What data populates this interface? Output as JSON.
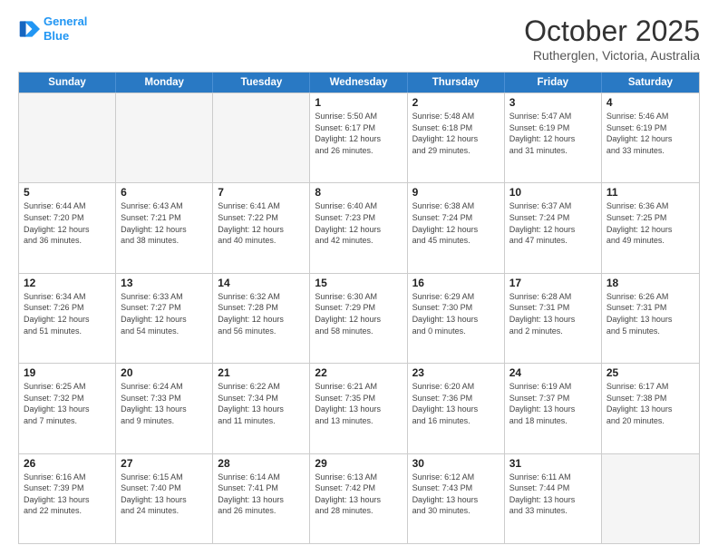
{
  "header": {
    "logo_line1": "General",
    "logo_line2": "Blue",
    "month": "October 2025",
    "location": "Rutherglen, Victoria, Australia"
  },
  "weekdays": [
    "Sunday",
    "Monday",
    "Tuesday",
    "Wednesday",
    "Thursday",
    "Friday",
    "Saturday"
  ],
  "rows": [
    [
      {
        "day": "",
        "info": ""
      },
      {
        "day": "",
        "info": ""
      },
      {
        "day": "",
        "info": ""
      },
      {
        "day": "1",
        "info": "Sunrise: 5:50 AM\nSunset: 6:17 PM\nDaylight: 12 hours\nand 26 minutes."
      },
      {
        "day": "2",
        "info": "Sunrise: 5:48 AM\nSunset: 6:18 PM\nDaylight: 12 hours\nand 29 minutes."
      },
      {
        "day": "3",
        "info": "Sunrise: 5:47 AM\nSunset: 6:19 PM\nDaylight: 12 hours\nand 31 minutes."
      },
      {
        "day": "4",
        "info": "Sunrise: 5:46 AM\nSunset: 6:19 PM\nDaylight: 12 hours\nand 33 minutes."
      }
    ],
    [
      {
        "day": "5",
        "info": "Sunrise: 6:44 AM\nSunset: 7:20 PM\nDaylight: 12 hours\nand 36 minutes."
      },
      {
        "day": "6",
        "info": "Sunrise: 6:43 AM\nSunset: 7:21 PM\nDaylight: 12 hours\nand 38 minutes."
      },
      {
        "day": "7",
        "info": "Sunrise: 6:41 AM\nSunset: 7:22 PM\nDaylight: 12 hours\nand 40 minutes."
      },
      {
        "day": "8",
        "info": "Sunrise: 6:40 AM\nSunset: 7:23 PM\nDaylight: 12 hours\nand 42 minutes."
      },
      {
        "day": "9",
        "info": "Sunrise: 6:38 AM\nSunset: 7:24 PM\nDaylight: 12 hours\nand 45 minutes."
      },
      {
        "day": "10",
        "info": "Sunrise: 6:37 AM\nSunset: 7:24 PM\nDaylight: 12 hours\nand 47 minutes."
      },
      {
        "day": "11",
        "info": "Sunrise: 6:36 AM\nSunset: 7:25 PM\nDaylight: 12 hours\nand 49 minutes."
      }
    ],
    [
      {
        "day": "12",
        "info": "Sunrise: 6:34 AM\nSunset: 7:26 PM\nDaylight: 12 hours\nand 51 minutes."
      },
      {
        "day": "13",
        "info": "Sunrise: 6:33 AM\nSunset: 7:27 PM\nDaylight: 12 hours\nand 54 minutes."
      },
      {
        "day": "14",
        "info": "Sunrise: 6:32 AM\nSunset: 7:28 PM\nDaylight: 12 hours\nand 56 minutes."
      },
      {
        "day": "15",
        "info": "Sunrise: 6:30 AM\nSunset: 7:29 PM\nDaylight: 12 hours\nand 58 minutes."
      },
      {
        "day": "16",
        "info": "Sunrise: 6:29 AM\nSunset: 7:30 PM\nDaylight: 13 hours\nand 0 minutes."
      },
      {
        "day": "17",
        "info": "Sunrise: 6:28 AM\nSunset: 7:31 PM\nDaylight: 13 hours\nand 2 minutes."
      },
      {
        "day": "18",
        "info": "Sunrise: 6:26 AM\nSunset: 7:31 PM\nDaylight: 13 hours\nand 5 minutes."
      }
    ],
    [
      {
        "day": "19",
        "info": "Sunrise: 6:25 AM\nSunset: 7:32 PM\nDaylight: 13 hours\nand 7 minutes."
      },
      {
        "day": "20",
        "info": "Sunrise: 6:24 AM\nSunset: 7:33 PM\nDaylight: 13 hours\nand 9 minutes."
      },
      {
        "day": "21",
        "info": "Sunrise: 6:22 AM\nSunset: 7:34 PM\nDaylight: 13 hours\nand 11 minutes."
      },
      {
        "day": "22",
        "info": "Sunrise: 6:21 AM\nSunset: 7:35 PM\nDaylight: 13 hours\nand 13 minutes."
      },
      {
        "day": "23",
        "info": "Sunrise: 6:20 AM\nSunset: 7:36 PM\nDaylight: 13 hours\nand 16 minutes."
      },
      {
        "day": "24",
        "info": "Sunrise: 6:19 AM\nSunset: 7:37 PM\nDaylight: 13 hours\nand 18 minutes."
      },
      {
        "day": "25",
        "info": "Sunrise: 6:17 AM\nSunset: 7:38 PM\nDaylight: 13 hours\nand 20 minutes."
      }
    ],
    [
      {
        "day": "26",
        "info": "Sunrise: 6:16 AM\nSunset: 7:39 PM\nDaylight: 13 hours\nand 22 minutes."
      },
      {
        "day": "27",
        "info": "Sunrise: 6:15 AM\nSunset: 7:40 PM\nDaylight: 13 hours\nand 24 minutes."
      },
      {
        "day": "28",
        "info": "Sunrise: 6:14 AM\nSunset: 7:41 PM\nDaylight: 13 hours\nand 26 minutes."
      },
      {
        "day": "29",
        "info": "Sunrise: 6:13 AM\nSunset: 7:42 PM\nDaylight: 13 hours\nand 28 minutes."
      },
      {
        "day": "30",
        "info": "Sunrise: 6:12 AM\nSunset: 7:43 PM\nDaylight: 13 hours\nand 30 minutes."
      },
      {
        "day": "31",
        "info": "Sunrise: 6:11 AM\nSunset: 7:44 PM\nDaylight: 13 hours\nand 33 minutes."
      },
      {
        "day": "",
        "info": ""
      }
    ]
  ]
}
